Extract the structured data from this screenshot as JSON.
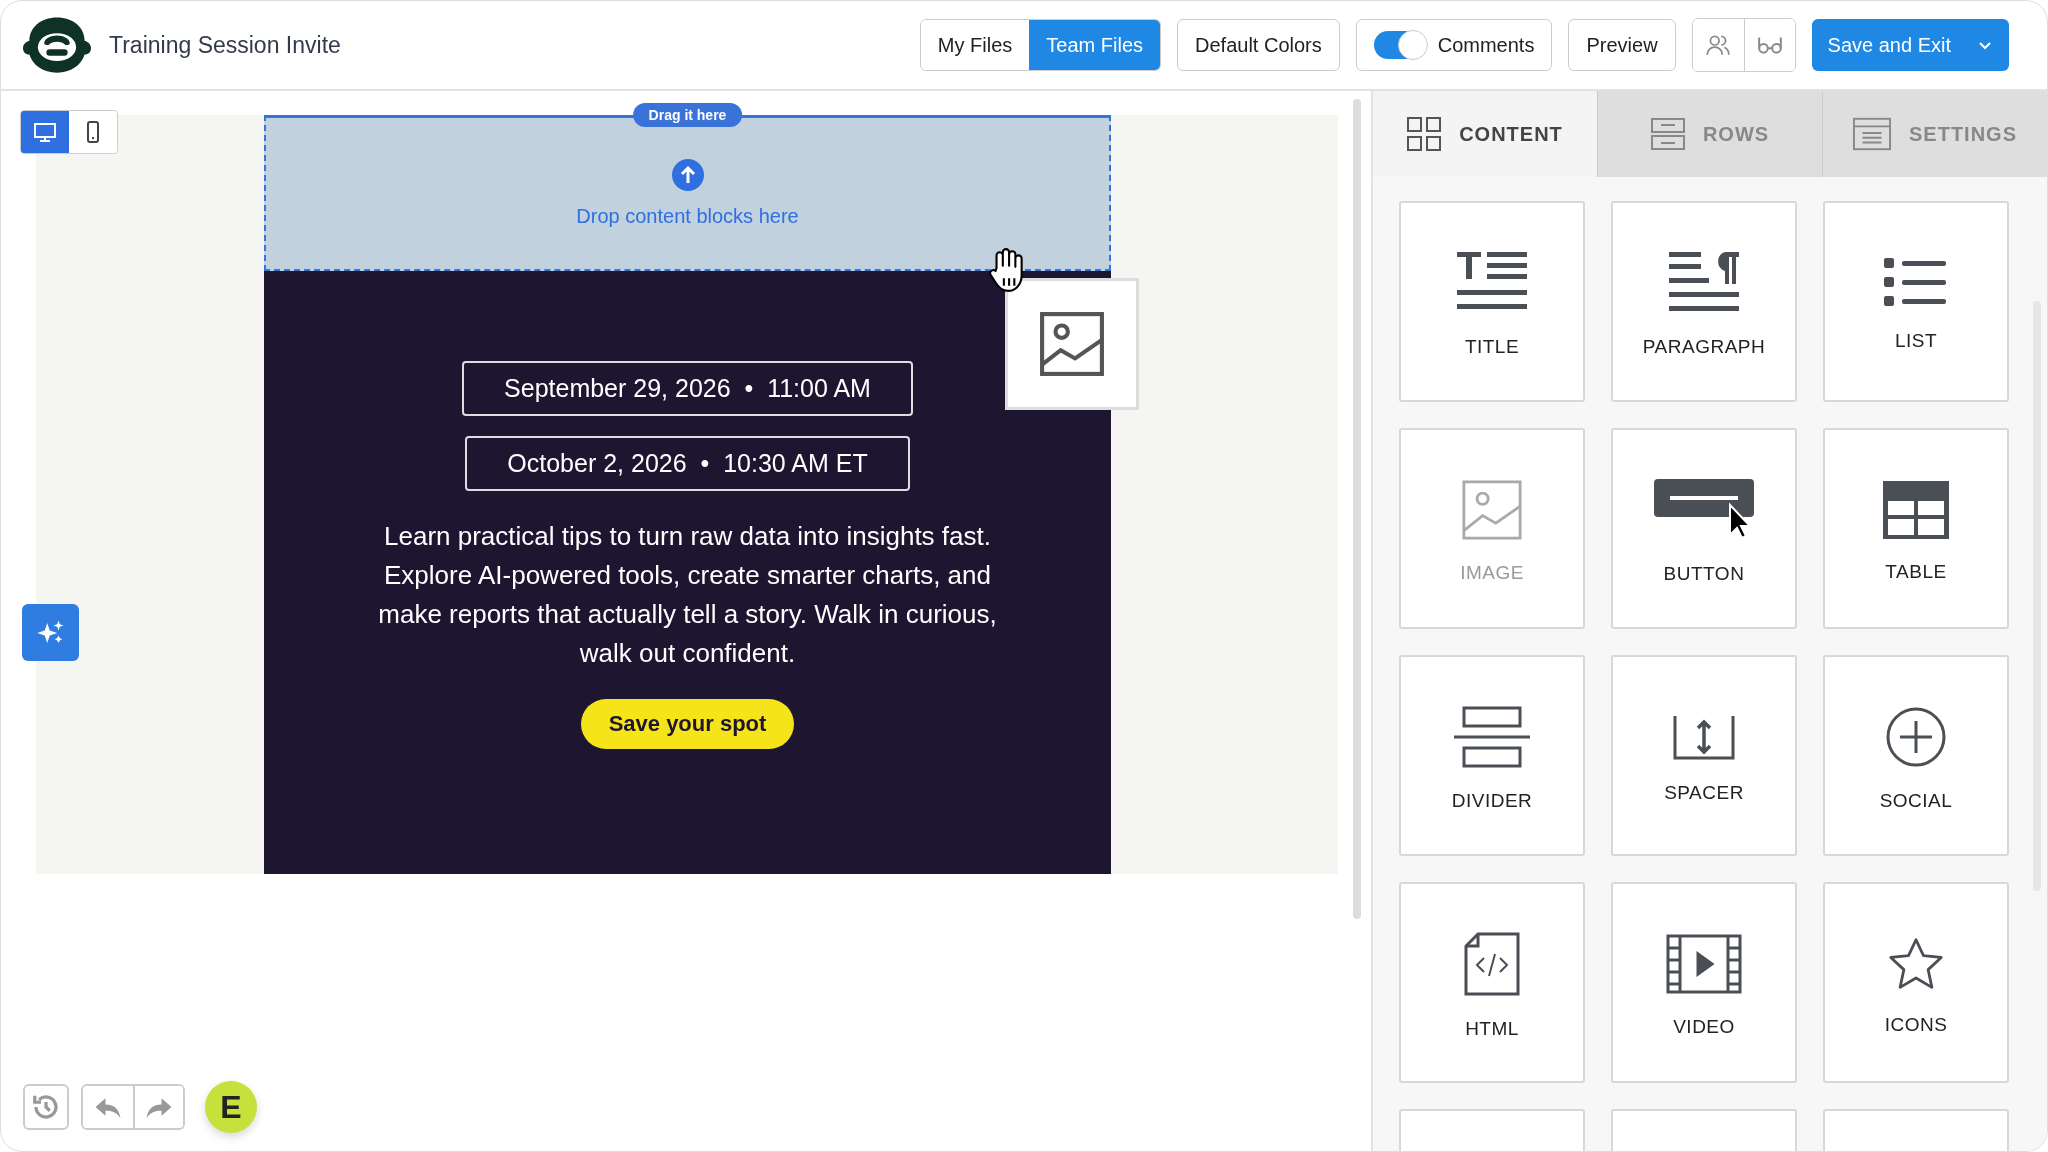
{
  "header": {
    "title": "Training Session Invite",
    "file_tabs": [
      {
        "label": "My Files",
        "selected": false
      },
      {
        "label": "Team Files",
        "selected": true
      }
    ],
    "default_colors": "Default Colors",
    "comments": {
      "label": "Comments",
      "on": true
    },
    "preview": "Preview",
    "save": "Save and Exit"
  },
  "view_modes": [
    {
      "kind": "desktop",
      "selected": true
    },
    {
      "kind": "mobile",
      "selected": false
    }
  ],
  "email": {
    "drag_hint": "Drag it here",
    "drop_text": "Drop content blocks here",
    "dates": [
      "September 29, 2026  •  11:00 AM",
      "October 2, 2026  •  10:30 AM ET"
    ],
    "body": "Learn practical tips to turn raw data into insights fast. Explore AI-powered tools, create smarter charts, and make reports that actually tell a story. Walk in curious, walk out confident.",
    "cta": "Save your spot"
  },
  "panel": {
    "tabs": [
      {
        "label": "CONTENT",
        "kind": "content",
        "selected": true
      },
      {
        "label": "ROWS",
        "kind": "rows",
        "selected": false
      },
      {
        "label": "SETTINGS",
        "kind": "settings",
        "selected": false
      }
    ],
    "blocks": [
      {
        "label": "TITLE",
        "kind": "title",
        "dragging": false
      },
      {
        "label": "PARAGRAPH",
        "kind": "paragraph",
        "dragging": false
      },
      {
        "label": "LIST",
        "kind": "list",
        "dragging": false
      },
      {
        "label": "IMAGE",
        "kind": "image",
        "dragging": true
      },
      {
        "label": "BUTTON",
        "kind": "button",
        "dragging": false
      },
      {
        "label": "TABLE",
        "kind": "table",
        "dragging": false
      },
      {
        "label": "DIVIDER",
        "kind": "divider",
        "dragging": false
      },
      {
        "label": "SPACER",
        "kind": "spacer",
        "dragging": false
      },
      {
        "label": "SOCIAL",
        "kind": "social",
        "dragging": false
      },
      {
        "label": "HTML",
        "kind": "html",
        "dragging": false
      },
      {
        "label": "VIDEO",
        "kind": "video",
        "dragging": false
      },
      {
        "label": "ICONS",
        "kind": "icons",
        "dragging": false
      }
    ]
  },
  "avatar": "E"
}
